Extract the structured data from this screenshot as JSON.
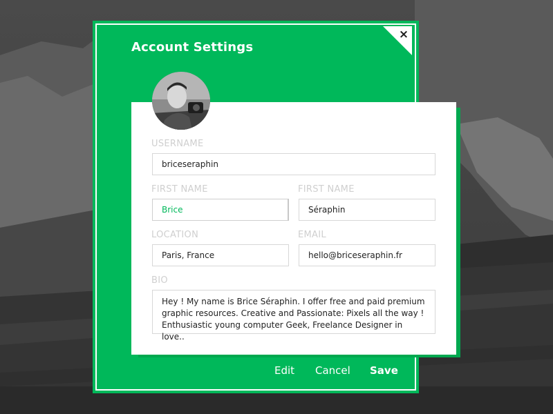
{
  "dialog": {
    "title": "Account Settings",
    "close_label": "×"
  },
  "profile": {
    "username": {
      "label": "USERNAME",
      "value": "briceseraphin"
    },
    "first_name": {
      "label": "FIRST NAME",
      "value": "Brice"
    },
    "last_name": {
      "label": "FIRST NAME",
      "value": "Séraphin"
    },
    "location": {
      "label": "LOCATION",
      "value": "Paris, France"
    },
    "email": {
      "label": "EMAIL",
      "value": "hello@briceseraphin.fr"
    },
    "bio": {
      "label": "BIO",
      "value": "Hey ! My name is Brice Séraphin. I offer free and paid premium\ngraphic resources. Creative and Passionate: Pixels all the way !\nEnthusiastic young computer Geek, Freelance Designer in love.."
    }
  },
  "actions": {
    "edit": "Edit",
    "cancel": "Cancel",
    "save": "Save"
  },
  "colors": {
    "accent": "#00b85a",
    "accent_dark": "#00a84f",
    "label": "#cfcfcf",
    "text": "#222222"
  }
}
